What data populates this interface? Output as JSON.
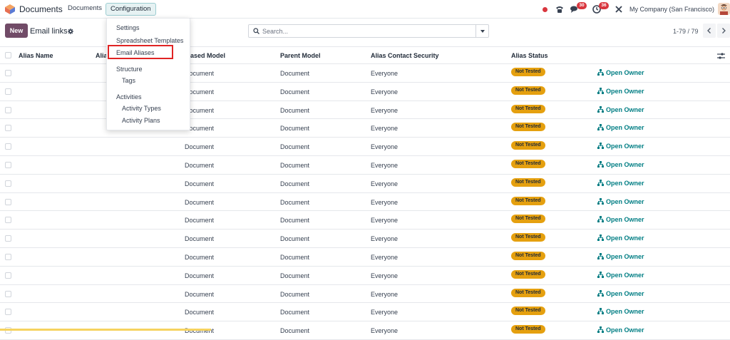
{
  "navbar": {
    "app_name": "Documents",
    "menus": [
      "Documents",
      "Configuration"
    ],
    "activity_badge": "30",
    "messages_badge": "36",
    "company": "My Company (San Francisco)",
    "icons": [
      "app-logo-icon",
      "status-dot",
      "phone-icon",
      "chat-icon",
      "clock-icon",
      "tools-icon",
      "avatar"
    ]
  },
  "control_panel": {
    "new_label": "New",
    "title": "Email links",
    "search_placeholder": "Search...",
    "pager": "1-79 / 79"
  },
  "dropdown": {
    "items": [
      {
        "label": "Settings",
        "type": "item"
      },
      {
        "label": "Spreadsheet Templates",
        "type": "item"
      },
      {
        "label": "Email Aliases",
        "type": "item",
        "highlighted": true
      },
      {
        "label": "Structure",
        "type": "section"
      },
      {
        "label": "Tags",
        "type": "item"
      },
      {
        "label": "Activities",
        "type": "section"
      },
      {
        "label": "Activity Types",
        "type": "item"
      },
      {
        "label": "Activity Plans",
        "type": "item"
      }
    ]
  },
  "table": {
    "headers": [
      "Alias Name",
      "Alia",
      "liased Model",
      "Parent Model",
      "Alias Contact Security",
      "Alias Status"
    ],
    "row_aliased_model": "Document",
    "row_parent_model": "Document",
    "row_security": "Everyone",
    "row_status": "Not Tested",
    "row_action": "Open Owner",
    "visible_rows": 15
  },
  "colors": {
    "brand": "#714b67",
    "accent": "#017e84",
    "badge": "#d9363e",
    "status": "#e5a00f",
    "highlight": "#e02424"
  }
}
